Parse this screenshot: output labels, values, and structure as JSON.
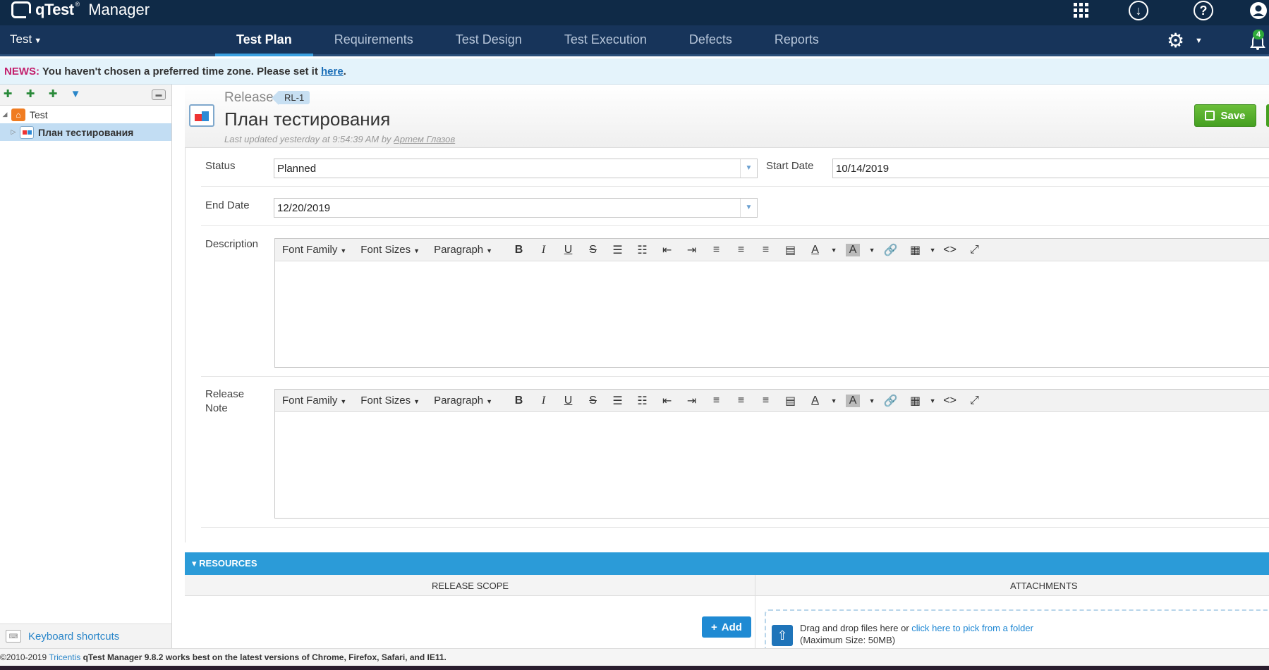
{
  "brand": {
    "name": "qTest",
    "tm": "®",
    "product": "Manager"
  },
  "top_icons": [
    "apps-grid-icon",
    "download-icon",
    "help-icon",
    "user-icon"
  ],
  "nav": {
    "project": "Test",
    "tabs": [
      "Test Plan",
      "Requirements",
      "Test Design",
      "Test Execution",
      "Defects",
      "Reports"
    ],
    "active_tab": "Test Plan",
    "notifications": "4"
  },
  "news": {
    "label": "NEWS:",
    "text": " You haven't chosen a preferred time zone. Please set it ",
    "link": "here",
    "end": "."
  },
  "tree": {
    "root": "Test",
    "child": "План тестирования"
  },
  "left_footer": {
    "shortcuts": "Keyboard shortcuts"
  },
  "header": {
    "type": "Release",
    "id": "RL-1",
    "title": "План тестирования",
    "meta_prefix": "Last updated yesterday at 9:54:39 AM by ",
    "meta_author": "Артем Глазов",
    "save": "Save"
  },
  "form": {
    "status_label": "Status",
    "status_value": "Planned",
    "start_label": "Start Date",
    "start_value": "10/14/2019",
    "end_label": "End Date",
    "end_value": "12/20/2019",
    "description_label": "Description",
    "release_note_label_1": "Release",
    "release_note_label_2": "Note"
  },
  "editor": {
    "font_family": "Font Family",
    "font_sizes": "Font Sizes",
    "paragraph": "Paragraph"
  },
  "resources": {
    "title": "RESOURCES",
    "scope": "RELEASE SCOPE",
    "attachments": "ATTACHMENTS",
    "add": "Add",
    "drop_text": "Drag and drop files here or ",
    "drop_link": "click here to pick from a folder",
    "drop_max": "(Maximum Size: 50MB)"
  },
  "footer": {
    "copy": "©2010-2019 ",
    "company": "Tricentis",
    "note": "  qTest Manager 9.8.2 works best on the latest versions of Chrome, Firefox, Safari, and IE11."
  },
  "colors": {
    "topbar": "#0f2a47",
    "navbar": "#17345a",
    "accent": "#2b9bd8",
    "save": "#45a021"
  }
}
